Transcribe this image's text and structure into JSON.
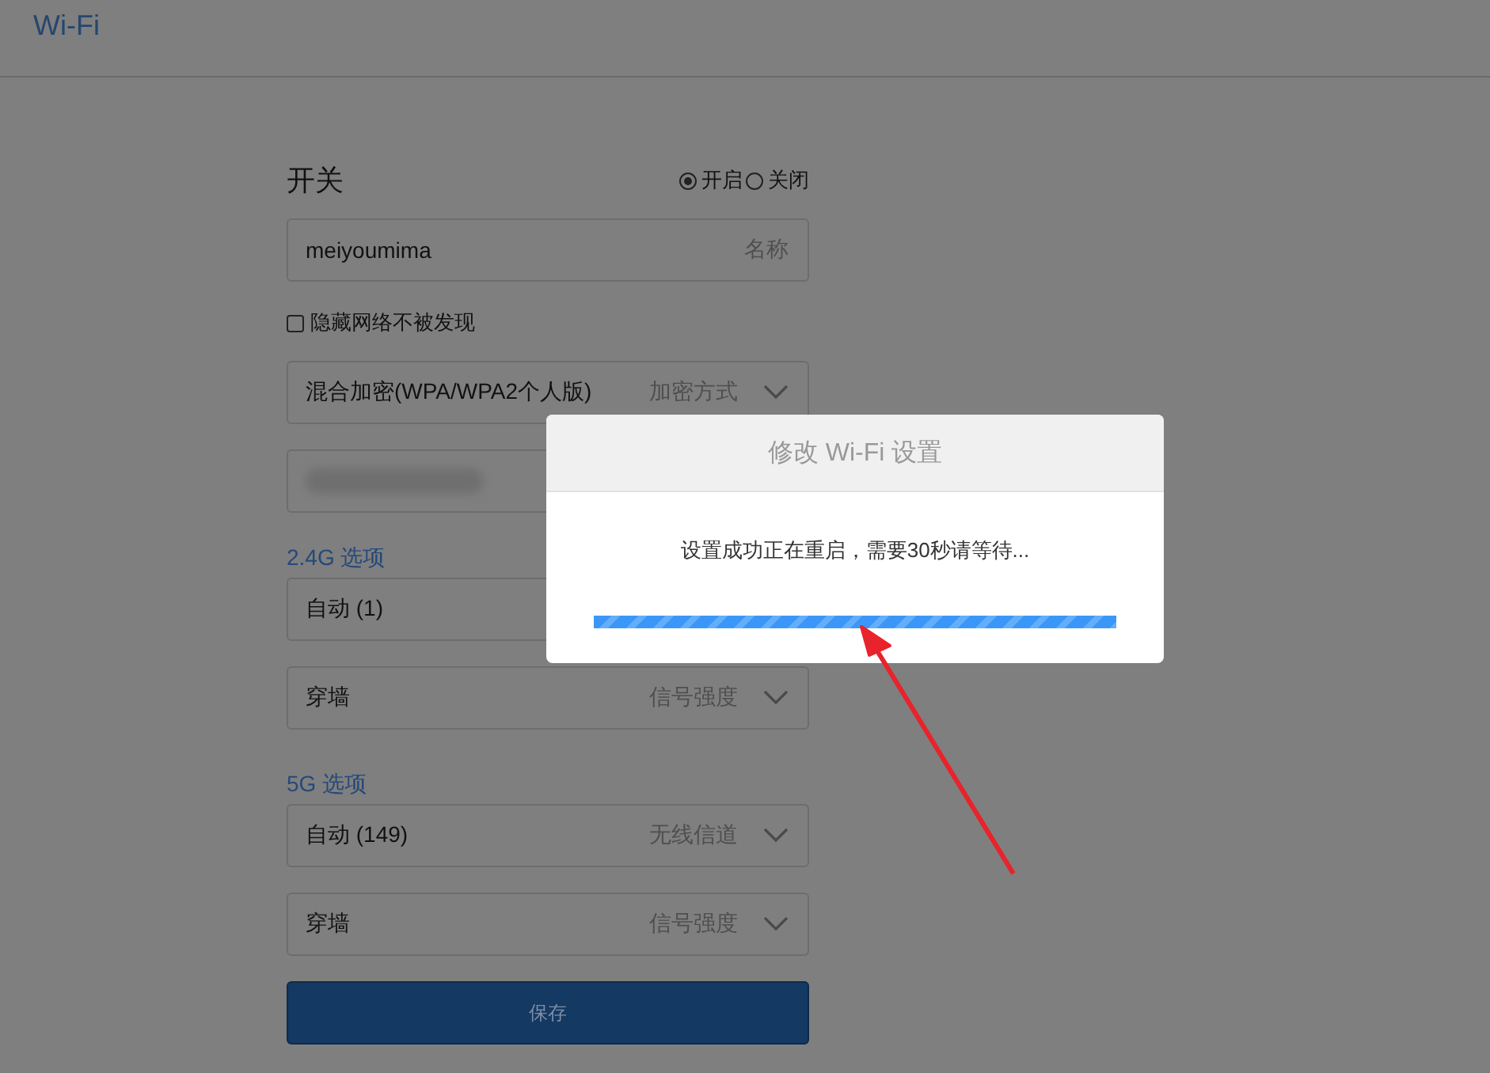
{
  "page": {
    "title": "Wi-Fi"
  },
  "switch": {
    "label": "开关",
    "options": [
      {
        "label": "开启",
        "selected": true
      },
      {
        "label": "关闭",
        "selected": false
      }
    ]
  },
  "name_field": {
    "value": "meiyoumima",
    "hint": "名称"
  },
  "hide_network": {
    "label": "隐藏网络不被发现",
    "checked": false
  },
  "encryption": {
    "value": "混合加密(WPA/WPA2个人版)",
    "hint": "加密方式"
  },
  "sections": [
    {
      "title": "2.4G 选项",
      "selects": [
        {
          "value": "自动 (1)"
        },
        {
          "value": "穿墙",
          "hint": "信号强度"
        }
      ]
    },
    {
      "title": "5G 选项",
      "selects": [
        {
          "value": "自动 (149)",
          "hint": "无线信道"
        },
        {
          "value": "穿墙",
          "hint": "信号强度"
        }
      ]
    }
  ],
  "save_button": "保存",
  "dialog": {
    "title": "修改 Wi-Fi 设置",
    "message": "设置成功正在重启，需要30秒请等待...",
    "progress": {
      "level": 1
    }
  }
}
